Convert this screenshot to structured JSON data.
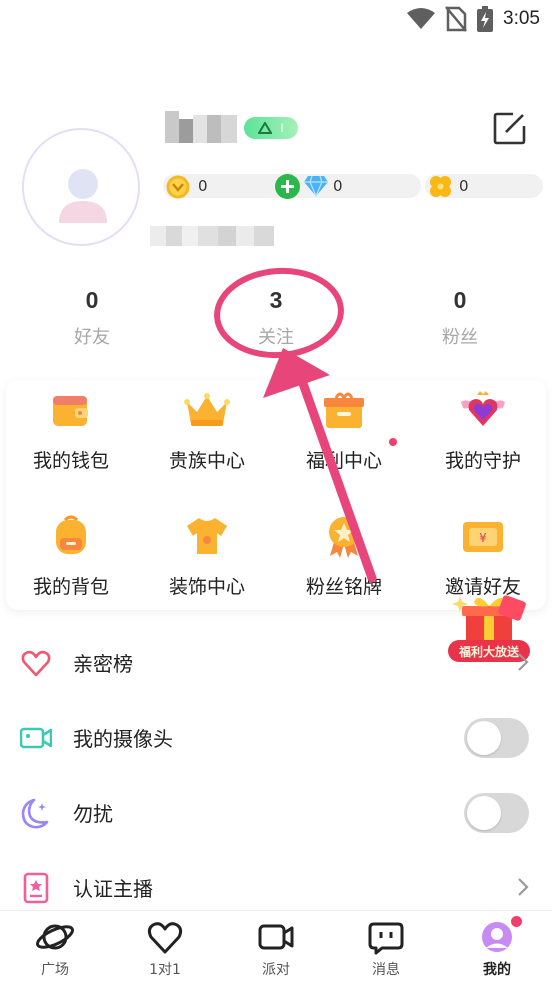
{
  "status_bar": {
    "time": "3:05",
    "icons": [
      "wifi-icon",
      "no-sim-icon",
      "battery-charging-icon"
    ]
  },
  "profile": {
    "username": "",
    "level_label": "I",
    "user_id": "",
    "currencies": {
      "coins": "0",
      "diamonds": "0",
      "clovers": "0"
    }
  },
  "stats": [
    {
      "value": "0",
      "label": "好友"
    },
    {
      "value": "3",
      "label": "关注"
    },
    {
      "value": "0",
      "label": "粉丝"
    }
  ],
  "grid": [
    {
      "label": "我的钱包",
      "icon": "wallet-icon"
    },
    {
      "label": "贵族中心",
      "icon": "crown-icon"
    },
    {
      "label": "福利中心",
      "icon": "gift-box-icon"
    },
    {
      "label": "我的守护",
      "icon": "winged-heart-icon"
    },
    {
      "label": "我的背包",
      "icon": "backpack-icon"
    },
    {
      "label": "装饰中心",
      "icon": "tshirt-icon"
    },
    {
      "label": "粉丝铭牌",
      "icon": "badge-icon"
    },
    {
      "label": "邀请好友",
      "icon": "invite-ticket-icon"
    }
  ],
  "promo": {
    "label": "福利大放送"
  },
  "list": [
    {
      "label": "亲密榜",
      "icon": "heart-outline-icon",
      "control": "chevron"
    },
    {
      "label": "我的摄像头",
      "icon": "camera-icon",
      "control": "toggle",
      "on": false
    },
    {
      "label": "勿扰",
      "icon": "moon-icon",
      "control": "toggle",
      "on": false
    },
    {
      "label": "认证主播",
      "icon": "certificate-icon",
      "control": "chevron"
    }
  ],
  "nav": [
    {
      "label": "广场",
      "icon": "planet-icon"
    },
    {
      "label": "1对1",
      "icon": "heart-nav-icon"
    },
    {
      "label": "派对",
      "icon": "video-icon"
    },
    {
      "label": "消息",
      "icon": "chat-icon"
    },
    {
      "label": "我的",
      "icon": "profile-nav-icon",
      "active": true
    }
  ],
  "colors": {
    "accent_pink": "#f03e6e",
    "annotation": "#e8457a",
    "level_green": "#5be39a",
    "toggle_off": "#d8d8d8"
  }
}
